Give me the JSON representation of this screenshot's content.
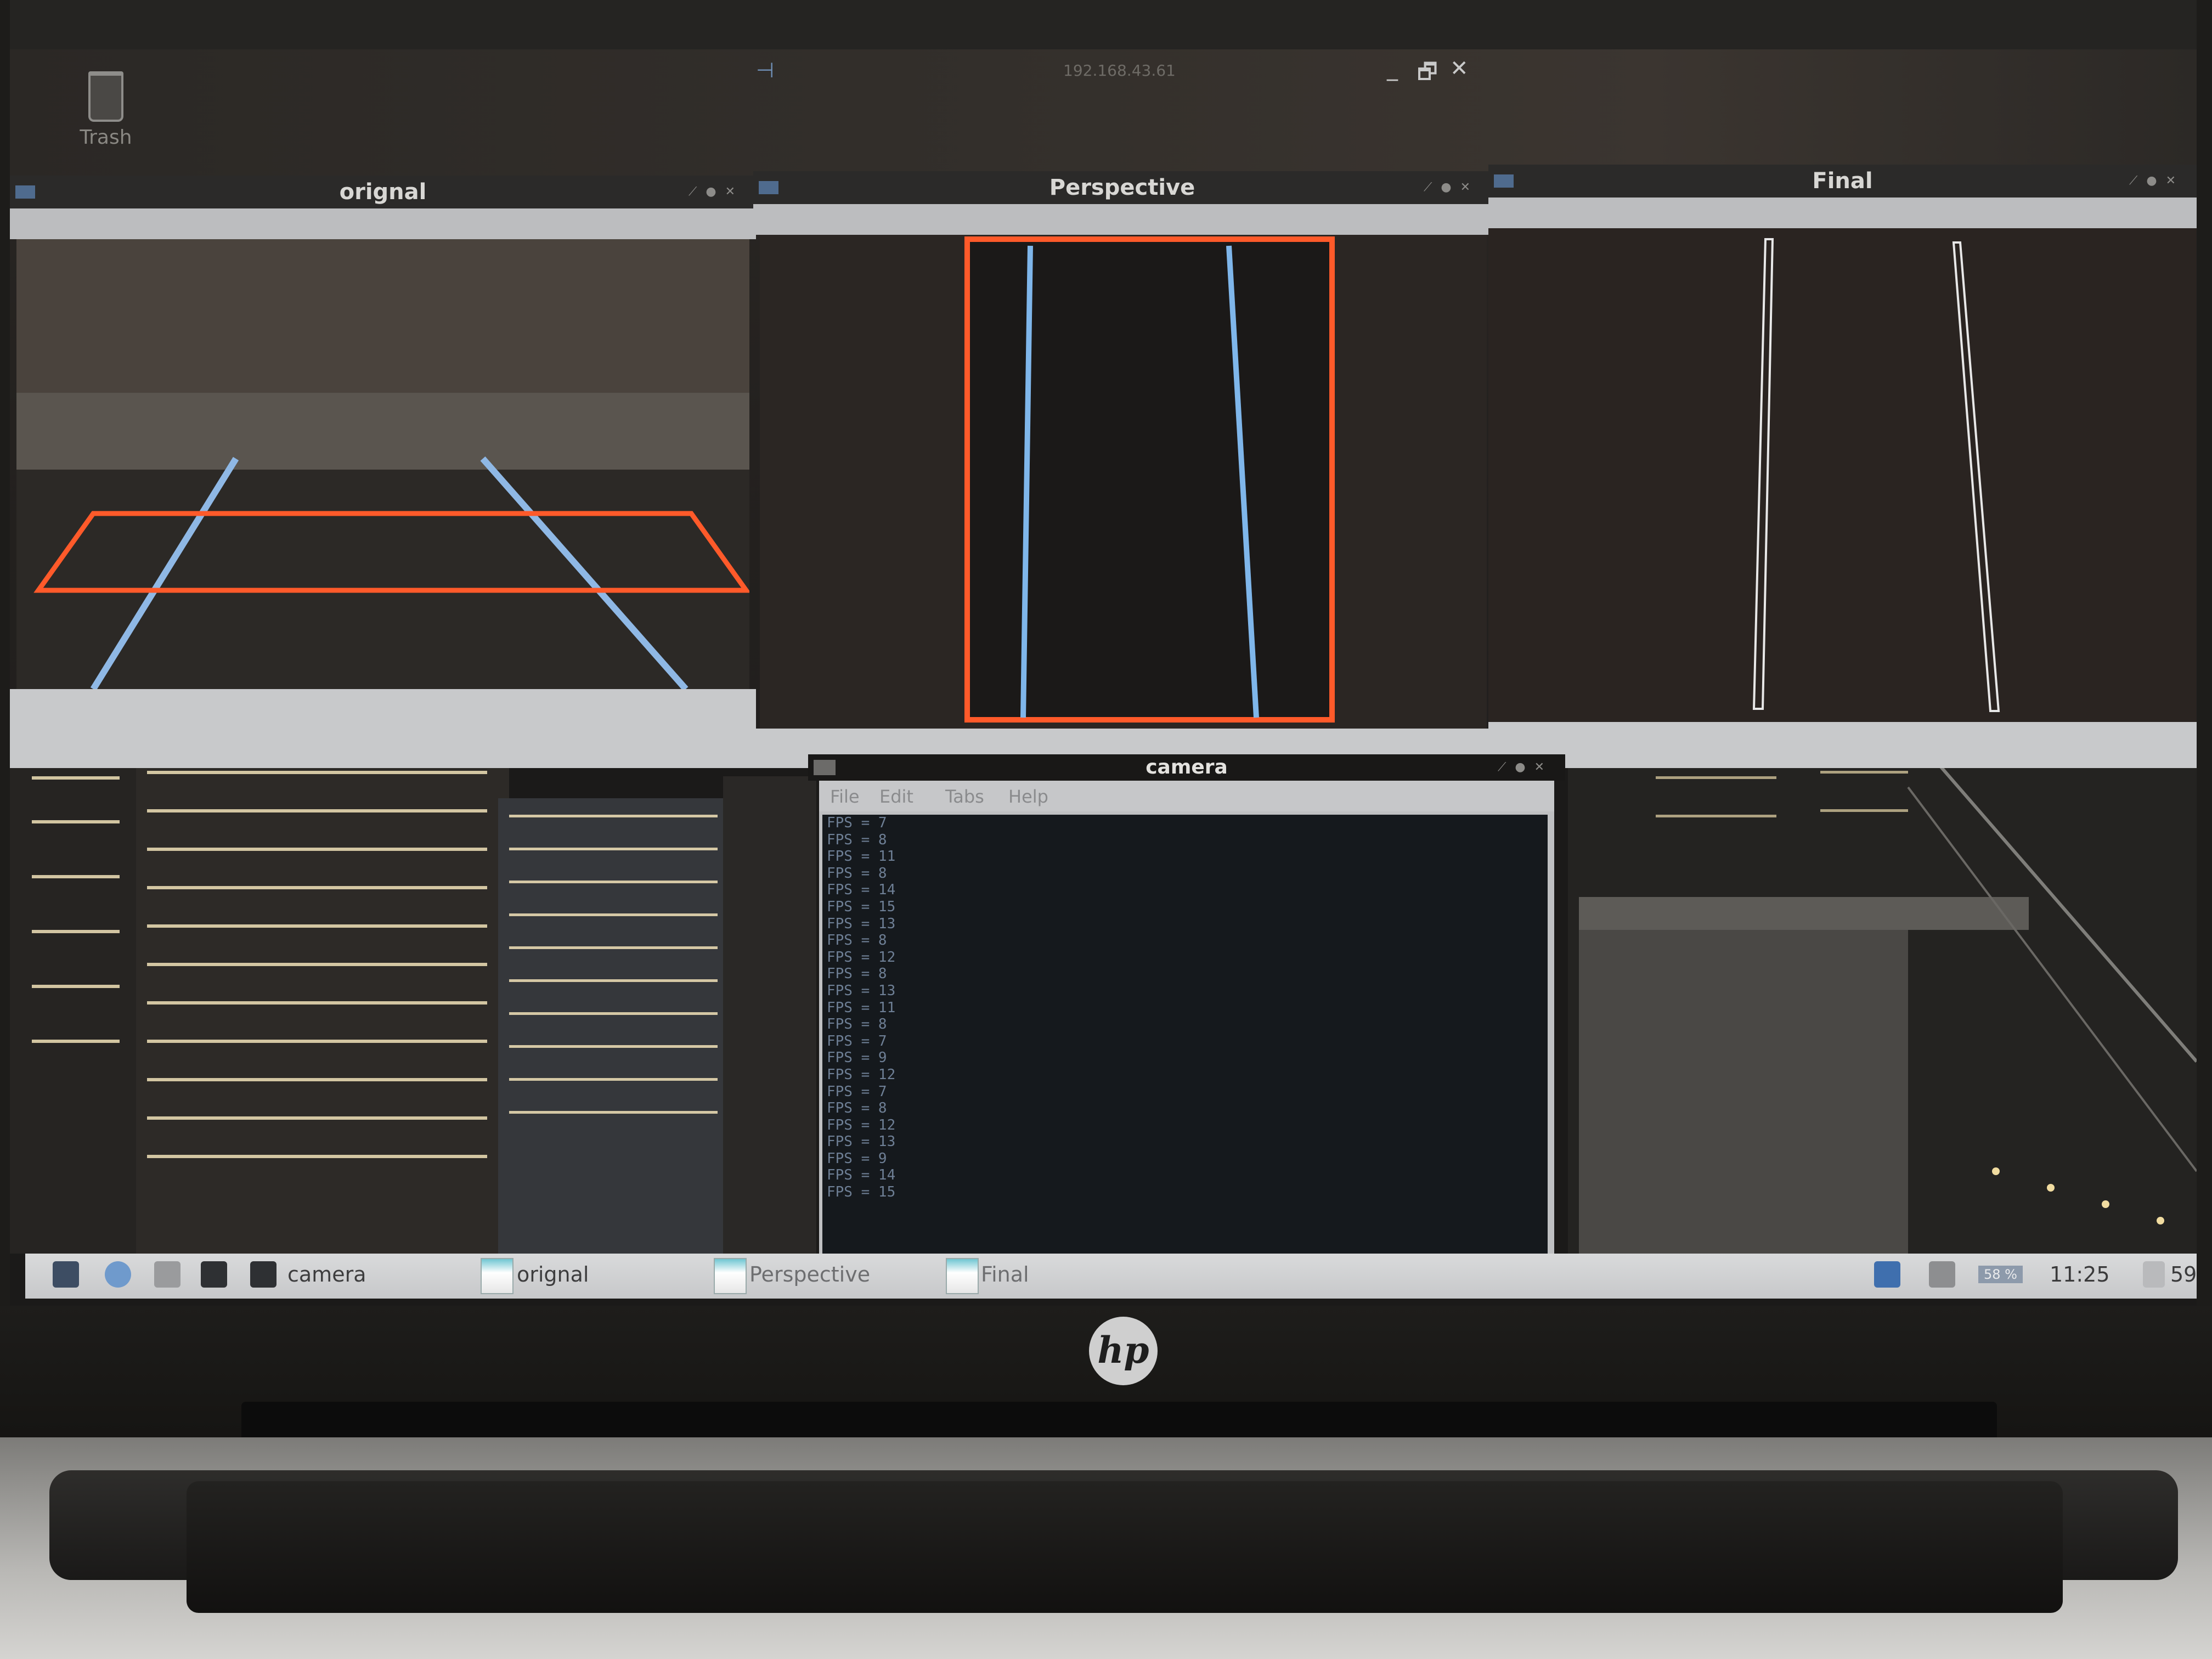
{
  "desktop": {
    "trash_label": "Trash",
    "remote_title": "192.168.43.61",
    "remote_controls": {
      "minimize": "_",
      "restore": "🗗",
      "close": "✕"
    }
  },
  "windows": {
    "original": {
      "title": "orignal"
    },
    "perspective": {
      "title": "Perspective"
    },
    "final": {
      "title": "Final"
    }
  },
  "terminal": {
    "title": "camera",
    "menu": [
      "File",
      "Edit",
      "Tabs",
      "Help"
    ],
    "lines": [
      "FPS = 7",
      "FPS = 8",
      "FPS = 11",
      "FPS = 8",
      "FPS = 14",
      "FPS = 15",
      "FPS = 13",
      "FPS = 8",
      "FPS = 12",
      "FPS = 8",
      "FPS = 13",
      "FPS = 11",
      "FPS = 8",
      "FPS = 7",
      "FPS = 9",
      "FPS = 12",
      "FPS = 7",
      "FPS = 8",
      "FPS = 12",
      "FPS = 13",
      "FPS = 9",
      "FPS = 14",
      "FPS = 15"
    ]
  },
  "taskbar": {
    "tasks": [
      "camera",
      "orignal",
      "Perspective",
      "Final"
    ],
    "volume": "58 %",
    "clock": "11:25",
    "battery": "59"
  },
  "laptop": {
    "logo": "hp"
  }
}
